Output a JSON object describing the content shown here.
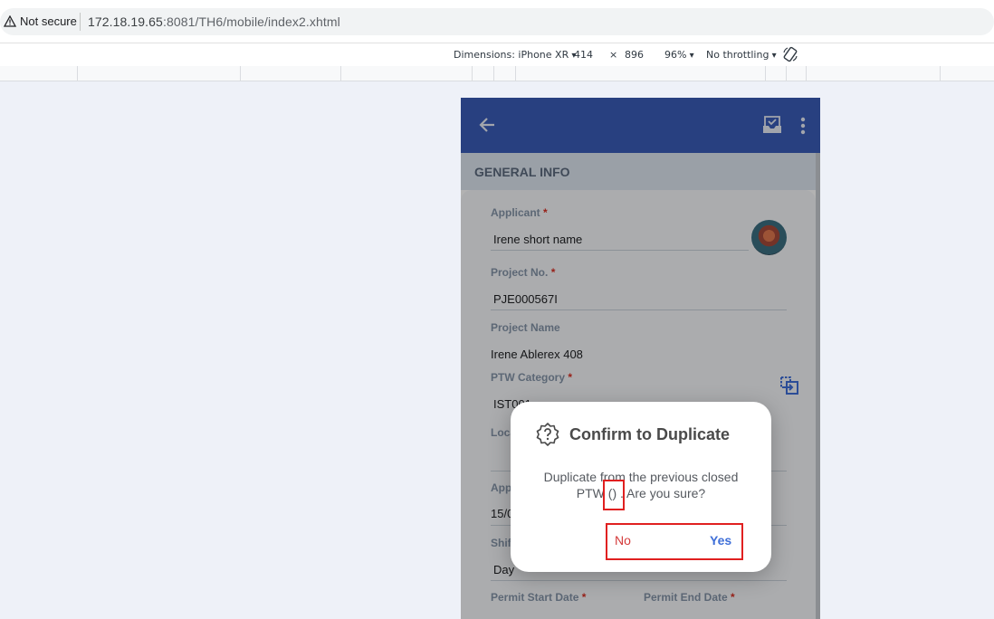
{
  "browser": {
    "security_label": "Not secure",
    "url_host": "172.18.19.65",
    "url_rest": ":8081/TH6/mobile/index2.xhtml"
  },
  "devtools": {
    "dimensions_label": "Dimensions: iPhone XR",
    "width": "414",
    "times": "×",
    "height": "896",
    "zoom": "96%",
    "throttling": "No throttling"
  },
  "appbar": {
    "back_icon": "arrow-left-icon",
    "inbox_icon": "inbox-check-icon",
    "menu_icon": "kebab-menu-icon",
    "color": "#3a5cb8"
  },
  "section": {
    "title": "GENERAL INFO"
  },
  "form": {
    "applicant_label": "Applicant",
    "applicant_value": "Irene short name",
    "project_no_label": "Project No.",
    "project_no_value": "PJE000567I",
    "project_name_label": "Project Name",
    "project_name_value": "Irene Ablerex 408",
    "ptw_category_label": "PTW Category",
    "ptw_category_value": "IST001",
    "location_label_partial": "Loca",
    "appl_label_partial": "Appl",
    "date_value_partial": "15/0",
    "shift_label_partial": "Shif",
    "shift_value": "Day",
    "permit_start_label": "Permit Start Date",
    "permit_end_label": "Permit End Date",
    "required_mark": "*"
  },
  "dialog": {
    "icon": "question-badge-icon",
    "title": "Confirm to Duplicate",
    "message_line1": "Duplicate from the previous closed",
    "message_line2_prefix": "PTW ",
    "message_parens": "()",
    "message_line2_suffix": ". Are you sure?",
    "no_label": "No",
    "yes_label": "Yes"
  },
  "colors": {
    "highlight": "#e02020",
    "no": "#d43a3a",
    "yes": "#3f6fd8"
  }
}
